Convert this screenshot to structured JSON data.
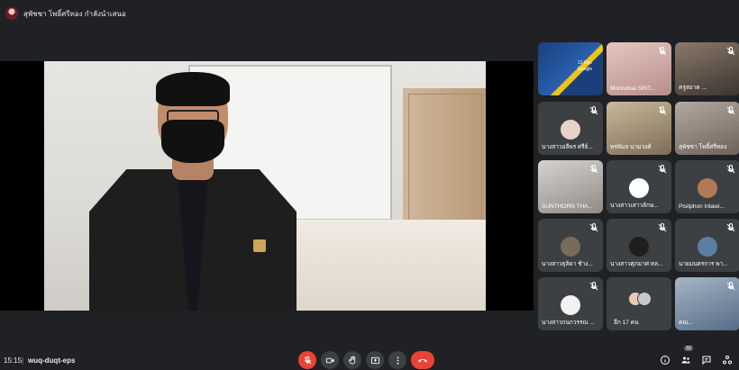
{
  "topbar": {
    "presenter_text": "สุพัชชา โพธิ์ศรีทอง กำลังนำเสนอ"
  },
  "colors": {
    "background": "#202124",
    "tile": "#3c4043",
    "accent_red": "#ea4335"
  },
  "tiles": [
    {
      "name": "",
      "type": "slide",
      "mic": "unmuted",
      "slide_line1": "13 Dec",
      "slide_line2": "Google"
    },
    {
      "name": "Monruthai SRIT...",
      "type": "camera",
      "mic": "muted"
    },
    {
      "name": "ครูสอาด ...",
      "type": "camera",
      "mic": "muted"
    },
    {
      "name": "นางสาวอลีพร ศรีย์...",
      "type": "avatar",
      "mic": "muted"
    },
    {
      "name": "พรพิมล นามวงศ์",
      "type": "camera",
      "mic": "muted"
    },
    {
      "name": "สุพัชชา โพธิ์ศรีทอง",
      "type": "camera",
      "mic": "muted"
    },
    {
      "name": "SUNTHORN THA...",
      "type": "camera",
      "mic": "muted"
    },
    {
      "name": "นางสาวเสาวลักษ...",
      "type": "avatar",
      "mic": "muted"
    },
    {
      "name": "Pisitphon Intawi...",
      "type": "avatar",
      "mic": "muted"
    },
    {
      "name": "นางสาวธุลิดา ช้าง...",
      "type": "avatar",
      "mic": "muted"
    },
    {
      "name": "นางสาวศุภมาศ ทล...",
      "type": "avatar",
      "mic": "muted"
    },
    {
      "name": "นายมนตรการ พา...",
      "type": "avatar",
      "mic": "muted"
    },
    {
      "name": "นางสาวกนกวรรณ ...",
      "type": "avatar",
      "mic": "muted"
    },
    {
      "name": "อีก 17 คน",
      "type": "more",
      "mic": "none"
    },
    {
      "name": "คณ...",
      "type": "camera",
      "mic": "muted"
    }
  ],
  "bottombar": {
    "time": "15:15",
    "separator": "|",
    "meeting_code": "wuq-duqt-eps",
    "people_count": "32",
    "controls": [
      "mic-off-icon",
      "camera-icon",
      "raise-hand-icon",
      "present-icon",
      "more-icon",
      "end-call-icon"
    ],
    "right_icons": [
      "info-icon",
      "people-icon",
      "chat-icon",
      "activities-icon"
    ]
  }
}
